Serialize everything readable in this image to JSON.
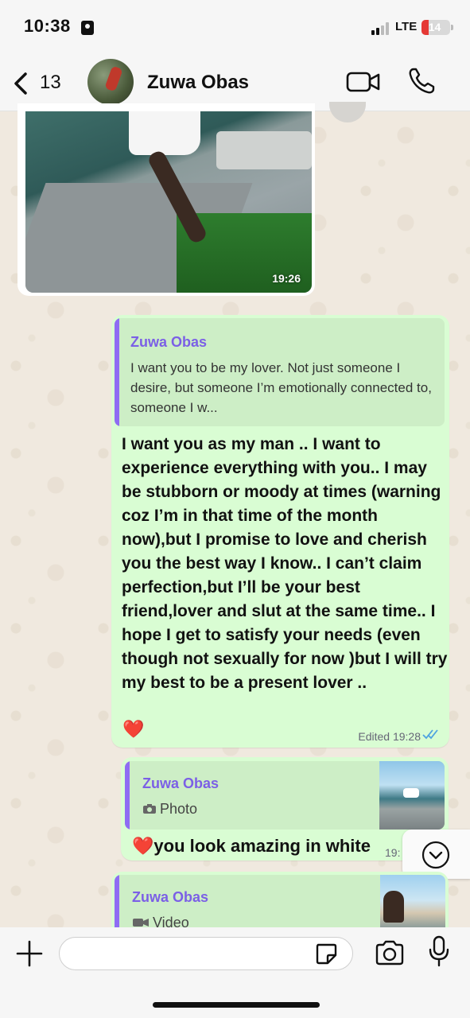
{
  "status_bar": {
    "time": "10:38",
    "network": "LTE",
    "battery": "14",
    "battery_color": "#e53935"
  },
  "header": {
    "back_count": "13",
    "contact_name": "Zuwa Obas",
    "icons": [
      "chevron-left-icon",
      "video-call-icon",
      "phone-icon"
    ]
  },
  "messages": [
    {
      "type": "photo",
      "direction": "incoming",
      "time": "19:26"
    },
    {
      "type": "text",
      "direction": "outgoing",
      "quoted": {
        "author": "Zuwa Obas",
        "text": "I want you to be my lover. Not just someone I desire, but someone I’m emotionally connected to, someone I w..."
      },
      "text": "I want you as my man .. I want to experience everything with you.. I may be stubborn or moody at times (warning coz I’m in that time of the month now),but I promise to love and cherish you the best way I know.. I can’t claim perfection,but I’ll be your best friend,lover  and slut at the same time.. I hope I get to satisfy your needs (even though not sexually for now )but  I will try my best to be a present lover ..",
      "emoji": "❤️",
      "edited_label": "Edited",
      "time": "19:28",
      "status": "read"
    },
    {
      "type": "text",
      "direction": "outgoing",
      "quoted": {
        "author": "Zuwa Obas",
        "media_label": "Photo"
      },
      "text": "❤️you look amazing in white",
      "time": "19:"
    },
    {
      "type": "text",
      "direction": "outgoing",
      "quoted": {
        "author": "Zuwa Obas",
        "media_label": "Video"
      }
    }
  ],
  "colors": {
    "outgoing_bubble": "#d9fdd3",
    "quote_bar": "#8e6cf3",
    "quote_name": "#7b5fe6",
    "read_ticks": "#4fa3e0"
  }
}
